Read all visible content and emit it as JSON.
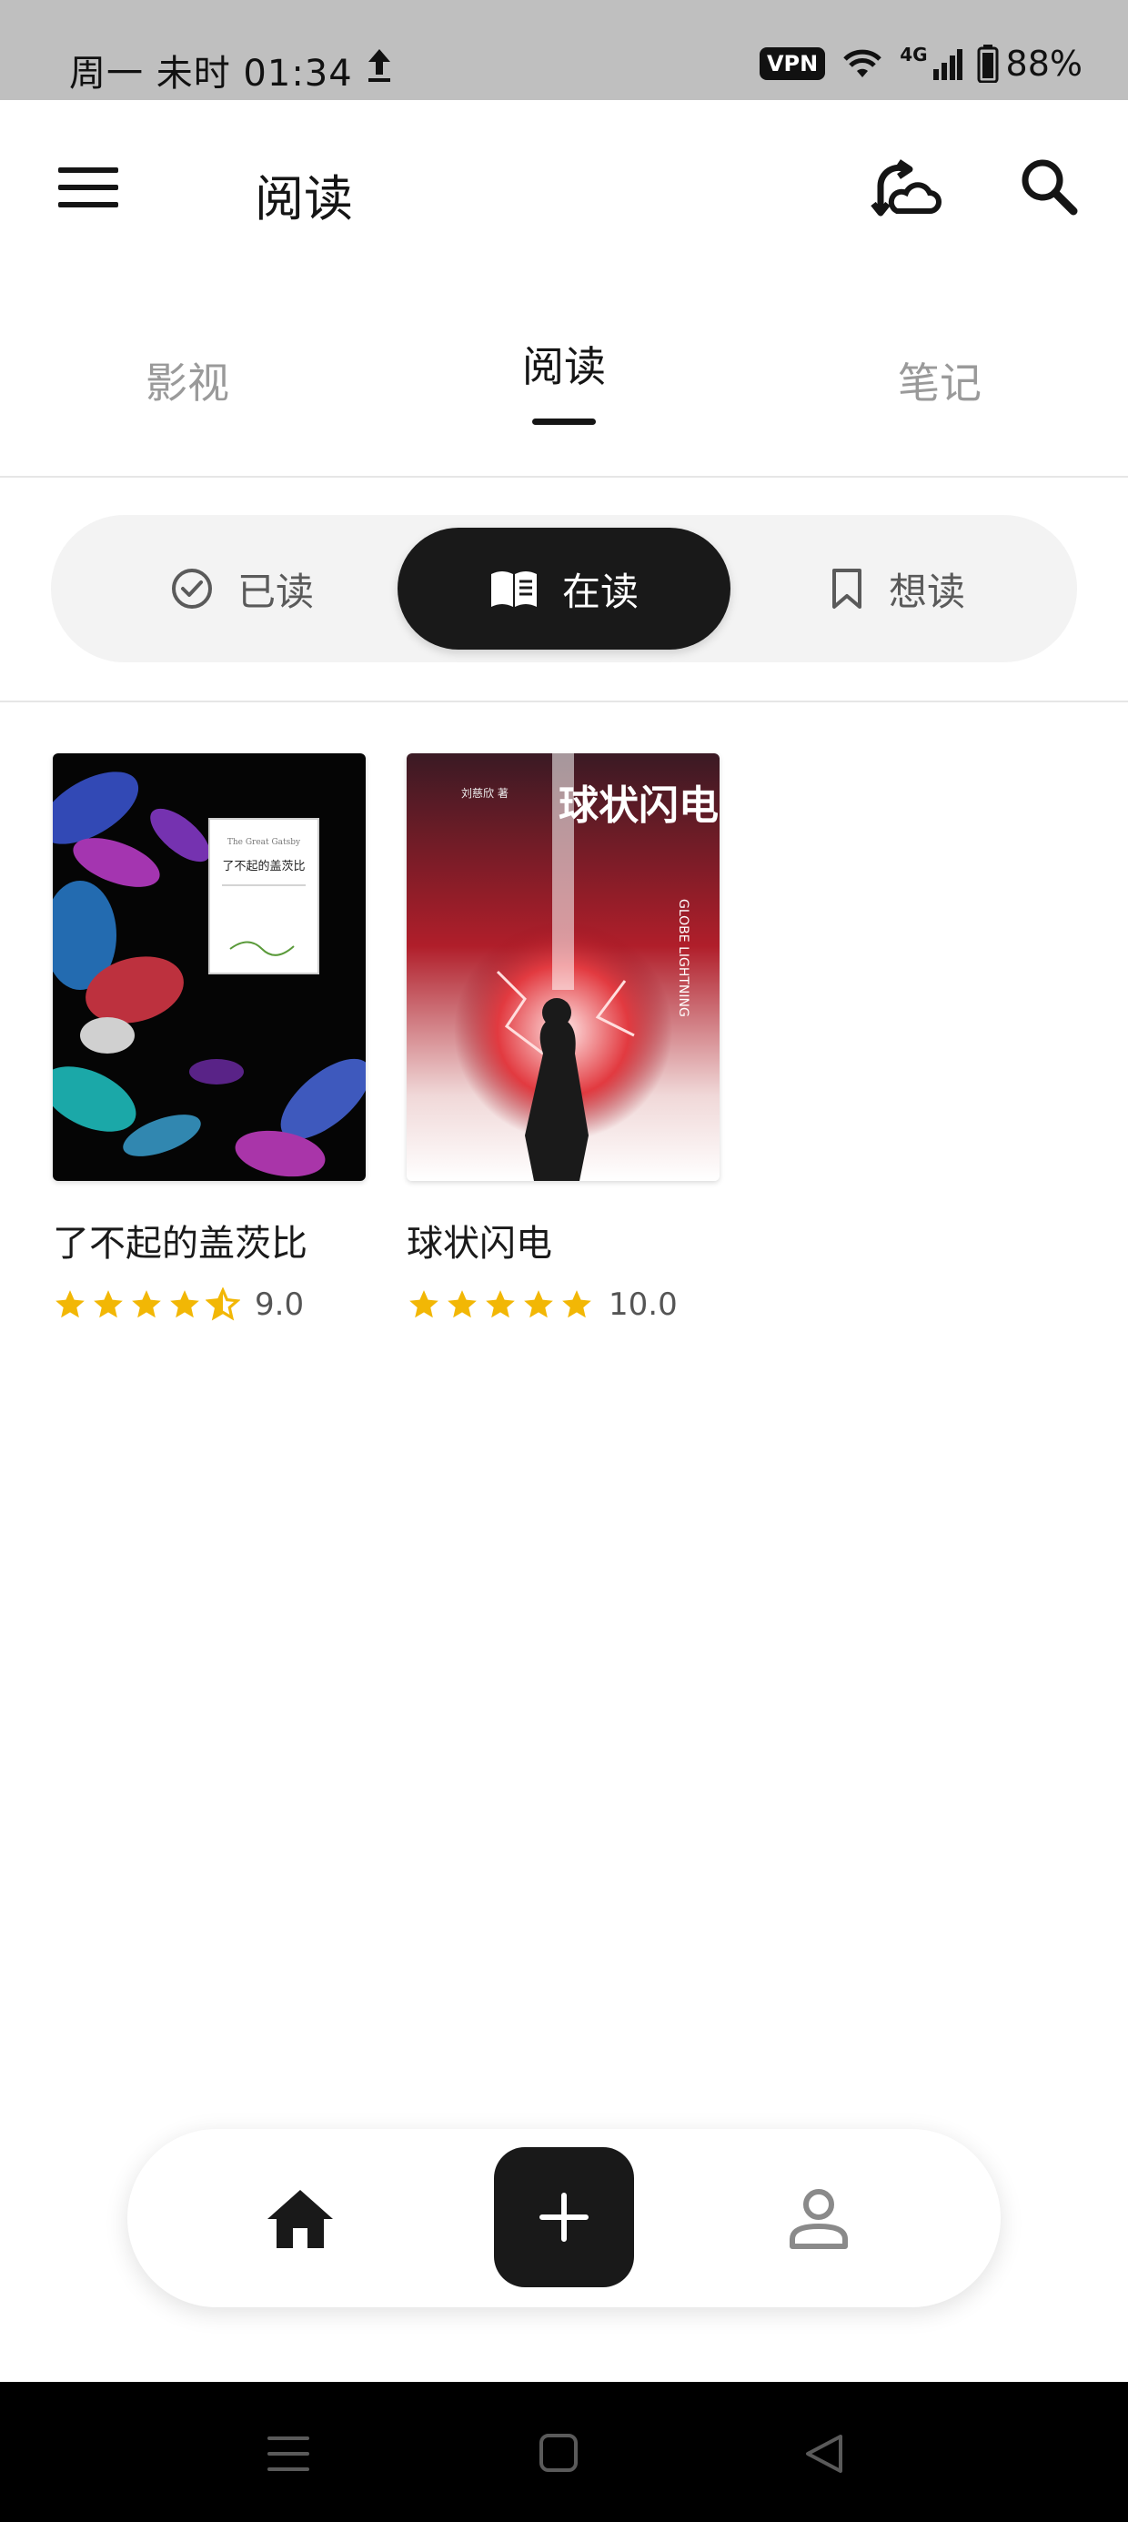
{
  "status_bar": {
    "time": "周一 未时 01:34",
    "vpn": "VPN",
    "network": "4G",
    "battery": "88%"
  },
  "header": {
    "title": "阅读"
  },
  "tabs": [
    {
      "label": "影视",
      "active": false
    },
    {
      "label": "阅读",
      "active": true
    },
    {
      "label": "笔记",
      "active": false
    }
  ],
  "segments": [
    {
      "label": "已读",
      "icon": "check-circle-icon",
      "active": false
    },
    {
      "label": "在读",
      "icon": "open-book-icon",
      "active": true
    },
    {
      "label": "想读",
      "icon": "bookmark-icon",
      "active": false
    }
  ],
  "books": [
    {
      "title": "了不起的盖茨比",
      "rating": "9.0",
      "stars": 4.5,
      "cover_small_text": "The Great Gatsby",
      "cover_title": "了不起的盖茨比"
    },
    {
      "title": "球状闪电",
      "rating": "10.0",
      "stars": 5,
      "cover_title": "球状闪电",
      "cover_author": "刘慈欣 著",
      "cover_en": "GLOBE LIGHTNING"
    }
  ],
  "colors": {
    "accent": "#191919",
    "star": "#f2b705",
    "star_empty": "#d8d8d8",
    "inactive_text": "#9a9a9a"
  },
  "bottom_nav": [
    {
      "icon": "home-icon"
    },
    {
      "icon": "plus-icon"
    },
    {
      "icon": "person-icon"
    }
  ],
  "system_nav": [
    {
      "icon": "menu-lines-icon"
    },
    {
      "icon": "square-icon"
    },
    {
      "icon": "back-triangle-icon"
    }
  ]
}
